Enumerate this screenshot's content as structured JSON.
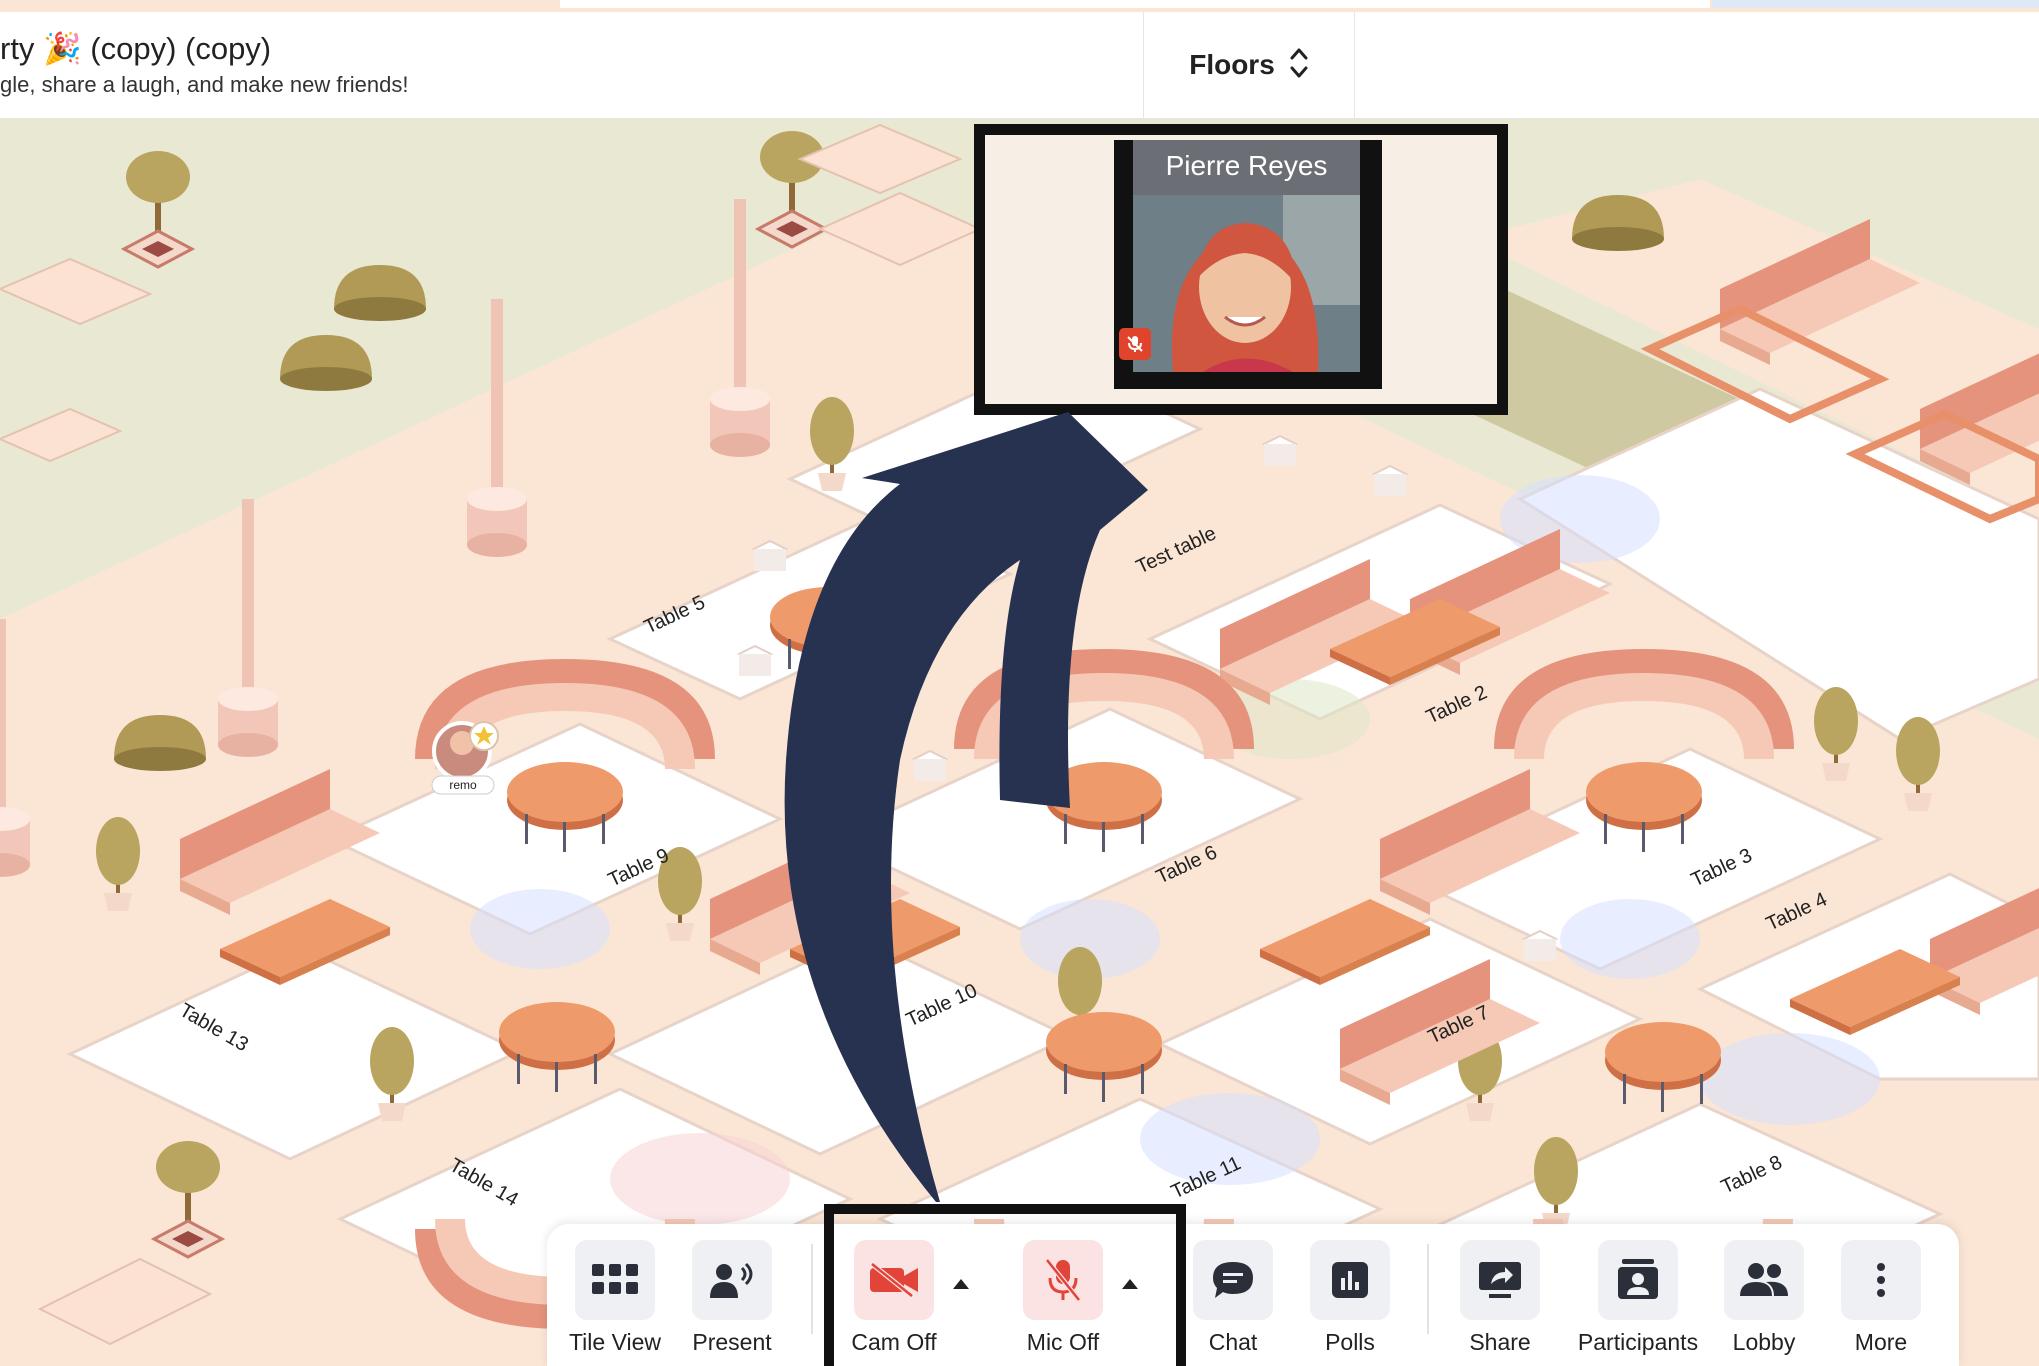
{
  "event": {
    "title": "rty 🎉 (copy) (copy)",
    "subtitle": "gle, share a laugh, and make new friends!"
  },
  "floors": {
    "label": "Floors"
  },
  "tables": [
    "Test table",
    "Table 5",
    "Table 2",
    "Table 9",
    "Table 6",
    "Table 3",
    "Table 4",
    "Table 13",
    "Table 10",
    "Table 7",
    "Table 14",
    "Table 11",
    "Table 8"
  ],
  "participant_badge": "remo",
  "video": {
    "name": "Pierre Reyes",
    "mic_status": "muted"
  },
  "toolbar": {
    "tile_view": "Tile View",
    "present": "Present",
    "cam": "Cam Off",
    "mic": "Mic Off",
    "chat": "Chat",
    "polls": "Polls",
    "share": "Share",
    "participants": "Participants",
    "lobby": "Lobby",
    "more": "More"
  },
  "colors": {
    "accent_red": "#e0442c",
    "arrow": "#26324f",
    "map_ground": "#e9e8d3",
    "floor": "#fbe6d6",
    "sofa": "#e9a78f",
    "table_top": "#e88d5d"
  }
}
